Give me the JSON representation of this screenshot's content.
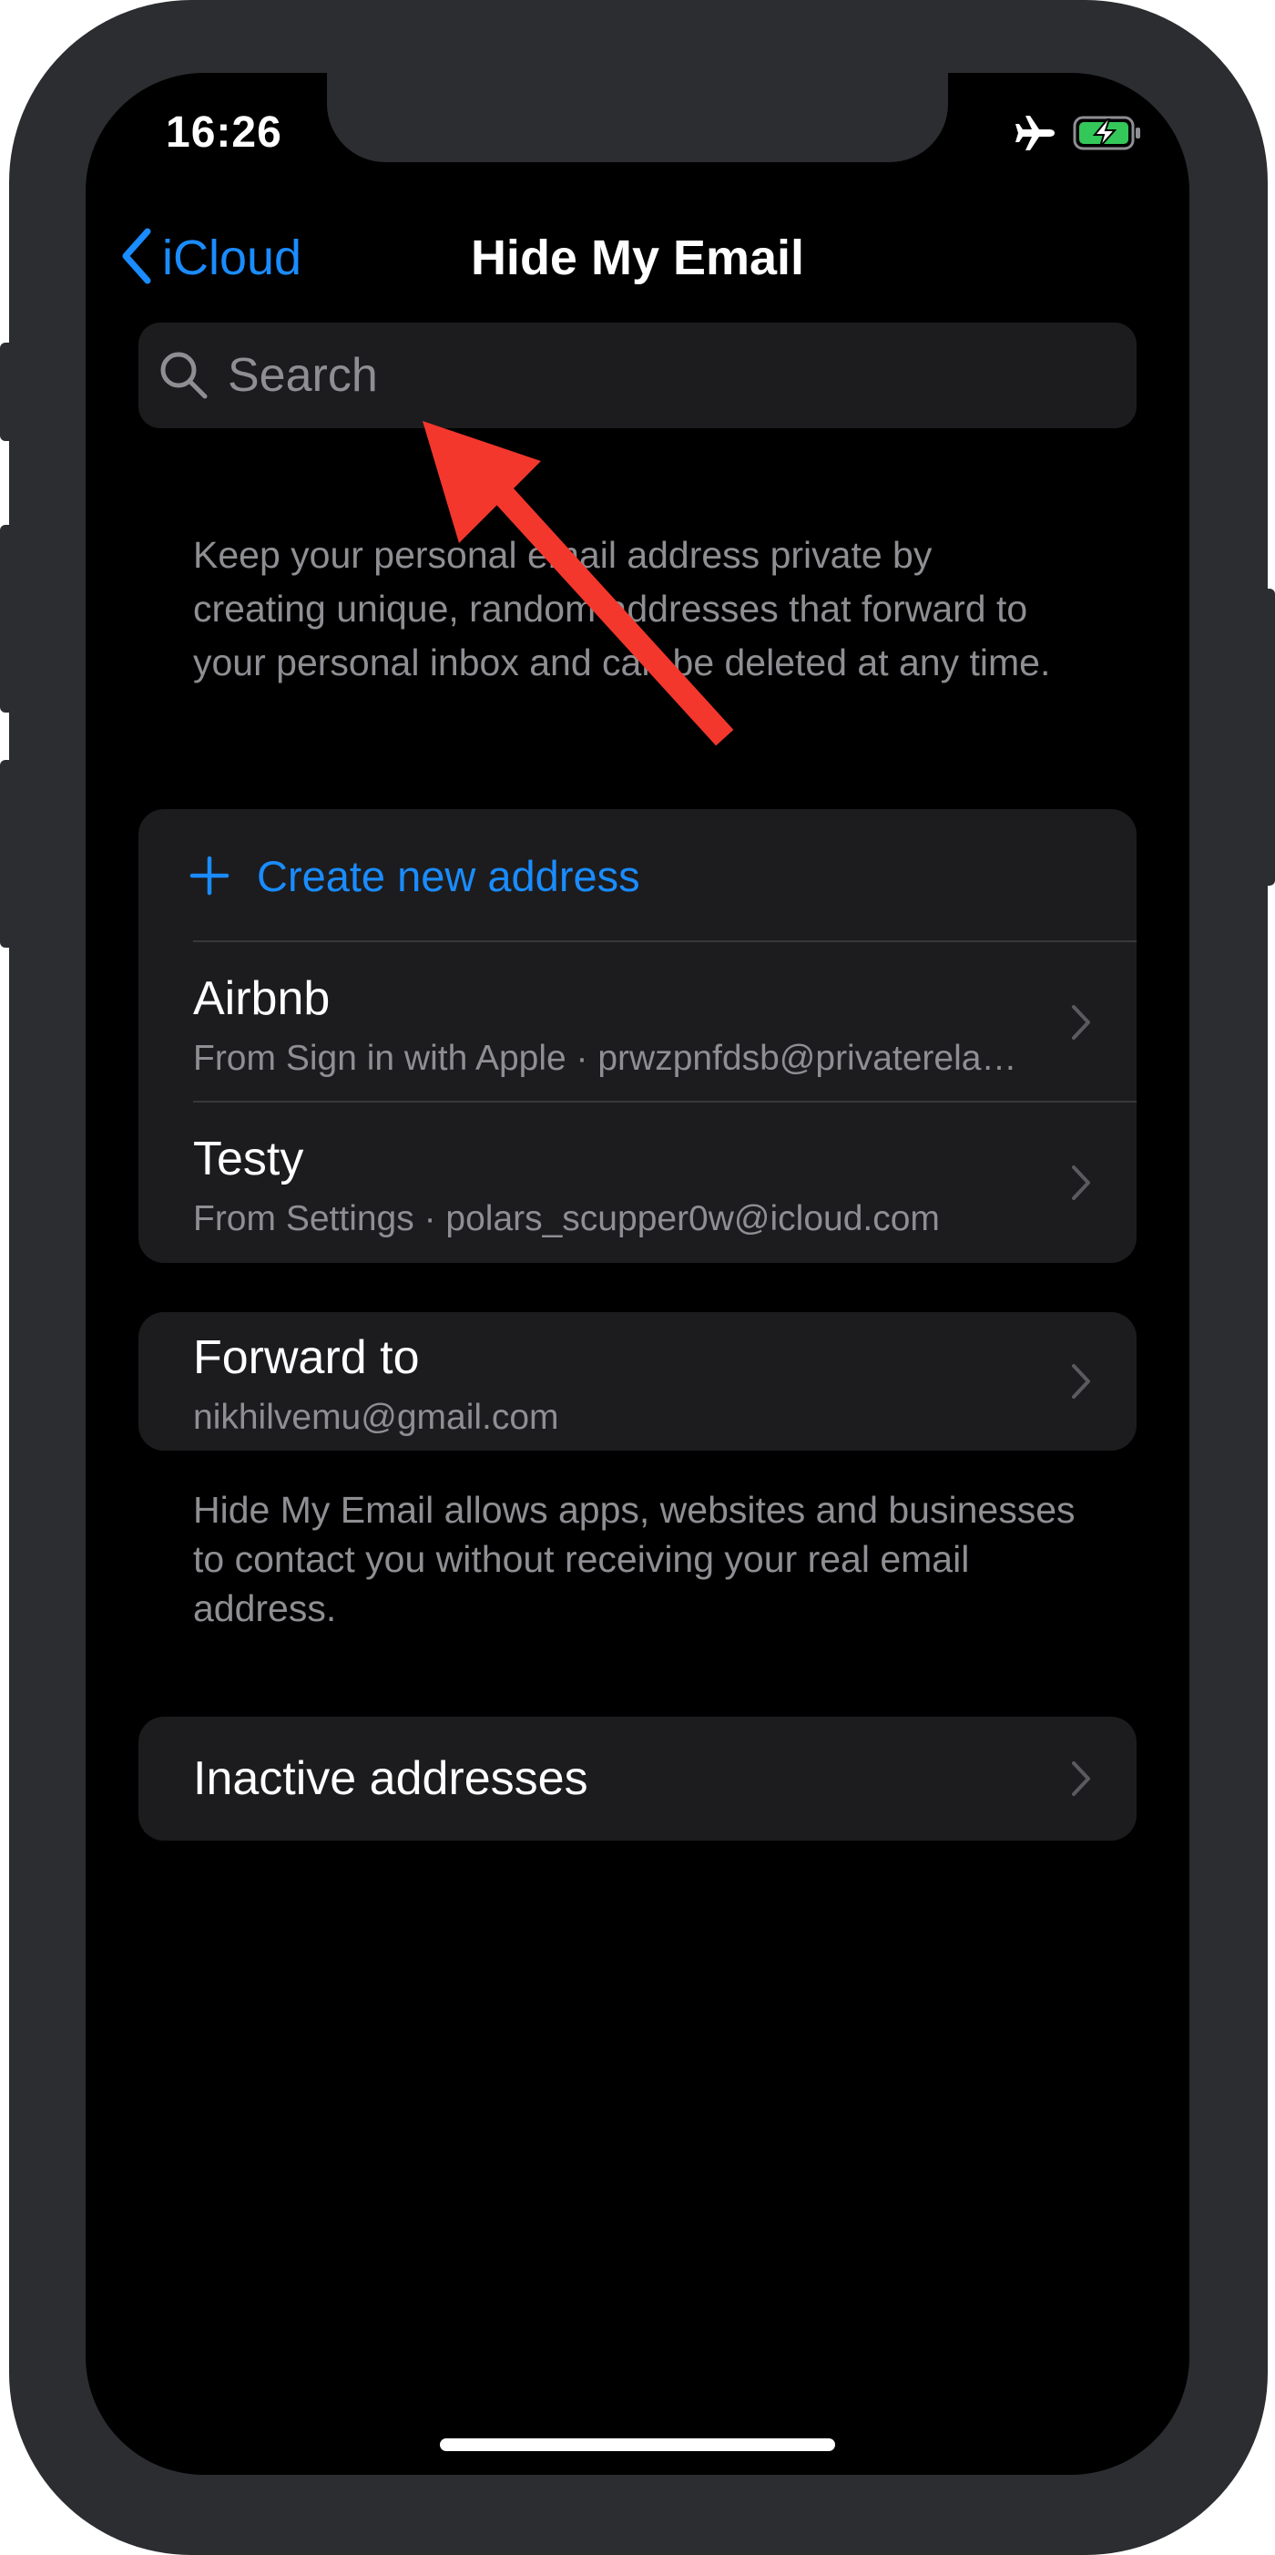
{
  "status_bar": {
    "time": "16:26",
    "icons": [
      "airplane-icon",
      "battery-charging-icon"
    ],
    "battery_color": "#34c759"
  },
  "nav": {
    "back_label": "iCloud",
    "title": "Hide My Email"
  },
  "search": {
    "placeholder": "Search"
  },
  "description": "Keep your personal email address private by creating unique, random addresses that forward to your personal inbox and can be deleted at any time.",
  "addresses_group": {
    "create_label": "Create new address",
    "items": [
      {
        "title": "Airbnb",
        "subtitle": "From Sign in with Apple · prwzpnfdsb@privaterelay.appleid.com"
      },
      {
        "title": "Testy",
        "subtitle": "From Settings · polars_scupper0w@icloud.com"
      }
    ]
  },
  "forward": {
    "title": "Forward to",
    "value": "nikhilvemu@gmail.com"
  },
  "footnote": "Hide My Email allows apps, websites and businesses to contact you without receiving your real email address.",
  "inactive": {
    "label": "Inactive addresses"
  },
  "colors": {
    "accent": "#1a8cff",
    "background": "#000000",
    "cell": "#1c1c1e",
    "secondary_text": "#8e8e93",
    "annotation_arrow": "#f3372d"
  }
}
